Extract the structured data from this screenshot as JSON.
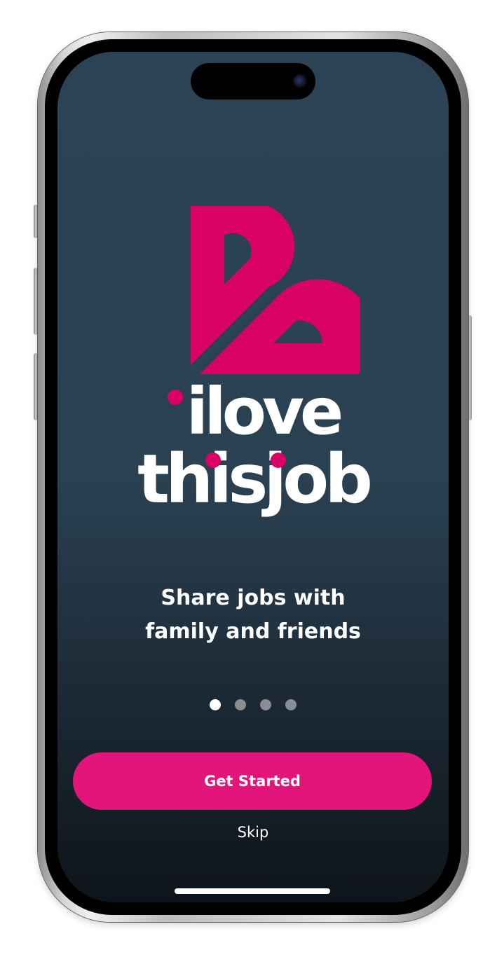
{
  "brand": {
    "logo_icon": "heart-drop-logo-icon",
    "wordmark_line1": "ilove",
    "wordmark_line2": "thisjob",
    "color": "#d90066"
  },
  "onboarding": {
    "tagline_line1": "Share jobs with",
    "tagline_line2": "family and friends",
    "page_count": 4,
    "current_page": 1,
    "primary_button_label": "Get Started",
    "skip_label": "Skip"
  },
  "colors": {
    "background_top": "#2b4355",
    "background_bottom": "#0e1419",
    "button": "#e3157a",
    "text": "#ffffff"
  }
}
